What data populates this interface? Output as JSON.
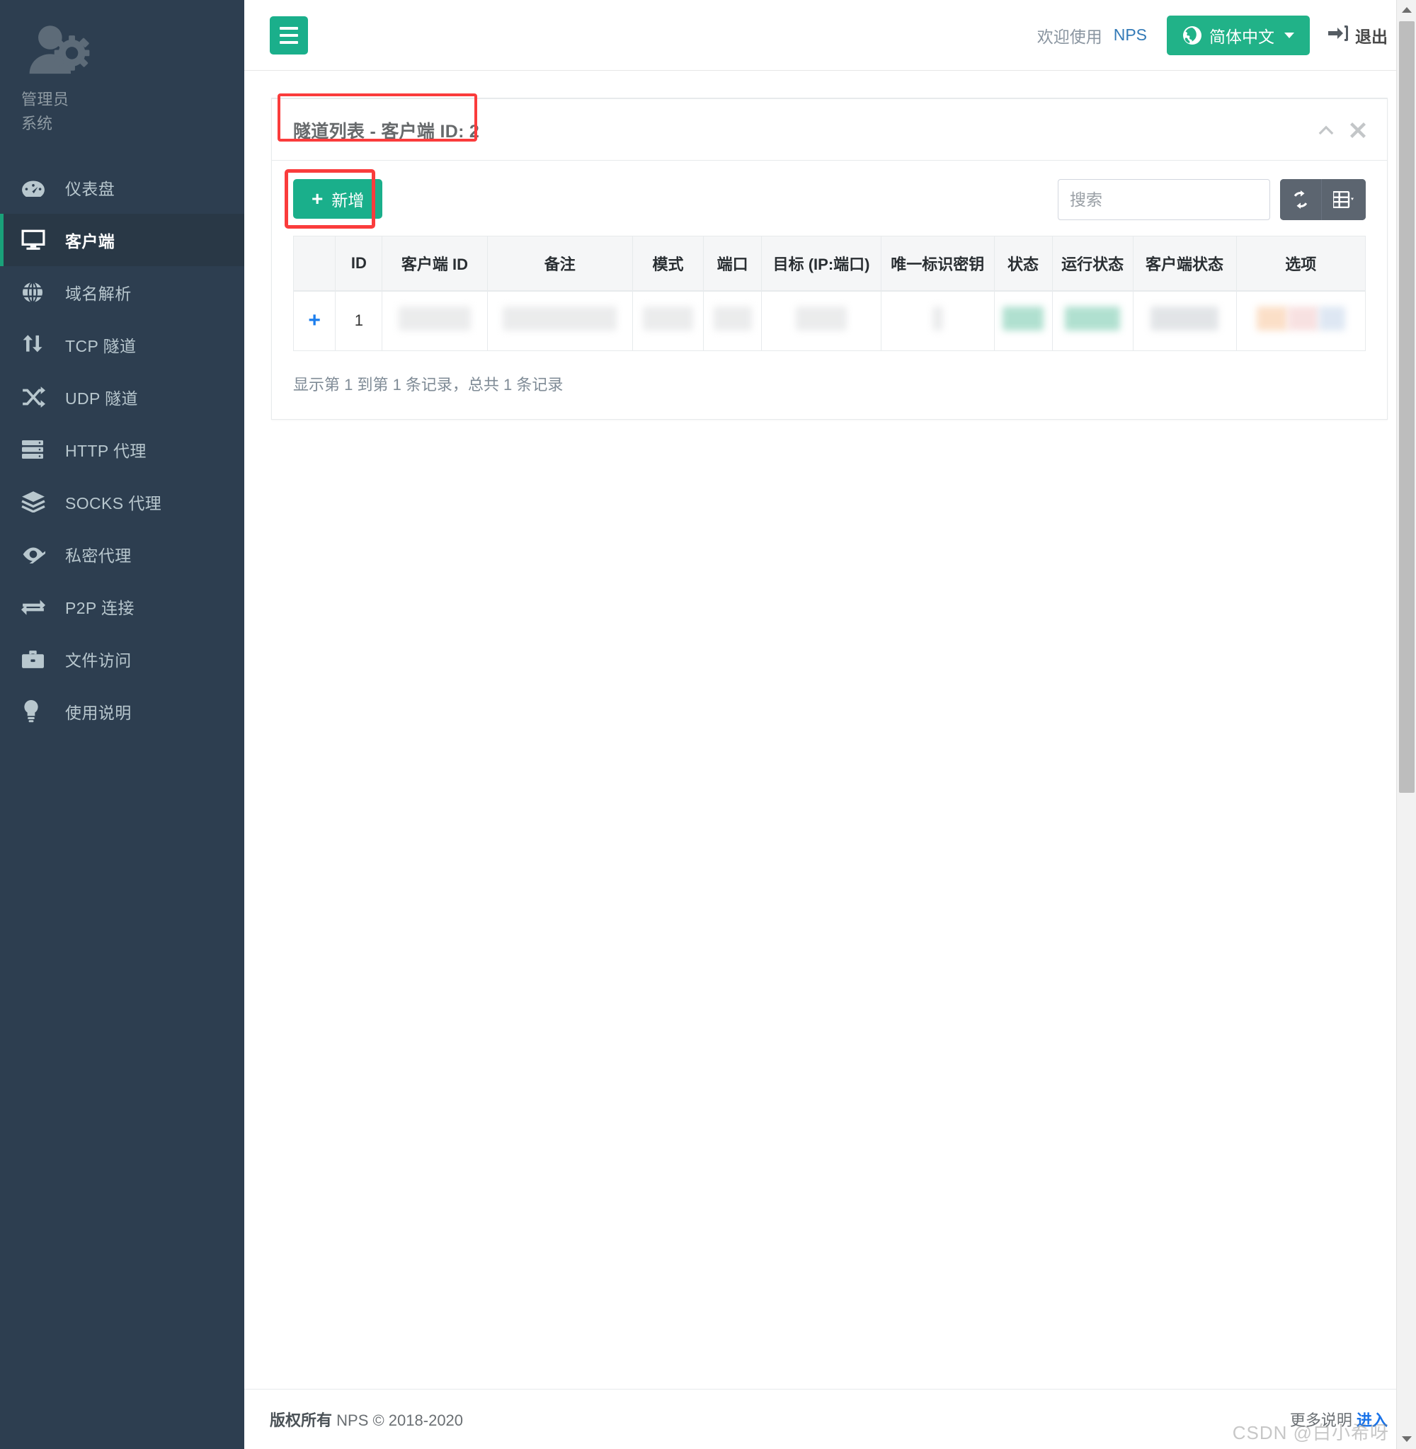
{
  "brand": {
    "primary_green": "#1aaf8b",
    "sidebar_bg": "#2d3e50",
    "sidebar_active_bg": "#293846",
    "accent_indicator": "#1aa179",
    "annotation_red": "#fa3c3c",
    "link_blue": "#337ab7"
  },
  "sidebar": {
    "profile": {
      "name": "管理员",
      "sub": "系统",
      "avatar_icon": "user-gear-icon"
    },
    "items": [
      {
        "label": "仪表盘",
        "icon": "dashboard-icon",
        "active": false
      },
      {
        "label": "客户端",
        "icon": "monitor-icon",
        "active": true
      },
      {
        "label": "域名解析",
        "icon": "globe-icon",
        "active": false
      },
      {
        "label": "TCP 隧道",
        "icon": "exchange-arrows-icon",
        "active": false
      },
      {
        "label": "UDP 隧道",
        "icon": "shuffle-icon",
        "active": false
      },
      {
        "label": "HTTP 代理",
        "icon": "server-icon",
        "active": false
      },
      {
        "label": "SOCKS 代理",
        "icon": "layers-icon",
        "active": false
      },
      {
        "label": "私密代理",
        "icon": "eye-slash-icon",
        "active": false
      },
      {
        "label": "P2P 连接",
        "icon": "transfer-icon",
        "active": false
      },
      {
        "label": "文件访问",
        "icon": "briefcase-icon",
        "active": false
      },
      {
        "label": "使用说明",
        "icon": "lightbulb-icon",
        "active": false
      }
    ]
  },
  "topbar": {
    "menu_toggle_icon": "hamburger-icon",
    "welcome_text": "欢迎使用",
    "app_link": "NPS",
    "language_label": "简体中文",
    "language_icon": "globe-icon",
    "logout_label": "退出",
    "logout_icon": "sign-out-icon"
  },
  "panel": {
    "title": "隧道列表 - 客户端 ID: 2",
    "collapse_icon": "chevron-up-icon",
    "close_icon": "close-icon",
    "annotations": [
      {
        "target": "panel-title",
        "color": "#fa3c3c"
      },
      {
        "target": "add-button",
        "color": "#fa3c3c"
      }
    ]
  },
  "toolbar": {
    "add_label": "新增",
    "add_icon": "plus-icon",
    "search_placeholder": "搜索",
    "search_value": "",
    "refresh_icon": "refresh-icon",
    "columns_icon": "columns-icon",
    "columns_caret_icon": "caret-down-icon"
  },
  "table": {
    "columns": [
      "",
      "ID",
      "客户端 ID",
      "备注",
      "模式",
      "端口",
      "目标 (IP:端口)",
      "唯一标识密钥",
      "状态",
      "运行状态",
      "客户端状态",
      "选项"
    ],
    "rows": [
      {
        "expand_icon": "plus-icon",
        "id": "1",
        "client_id": "",
        "remark": "",
        "mode": "",
        "port": "",
        "target": "",
        "unique_key": "",
        "status": "",
        "run_status": "",
        "client_status": "",
        "options": "",
        "redacted": true
      }
    ],
    "footer_text": "显示第 1 到第 1 条记录，总共 1 条记录"
  },
  "page_footer": {
    "copyright_strong": "版权所有",
    "copyright_rest": "NPS © 2018-2020",
    "more_text": "更多说明",
    "more_link": "进入"
  },
  "watermark": "CSDN @白小希呀",
  "scrollbar": {
    "up_arrow_icon": "triangle-up-icon",
    "down_arrow_icon": "triangle-down-icon"
  }
}
